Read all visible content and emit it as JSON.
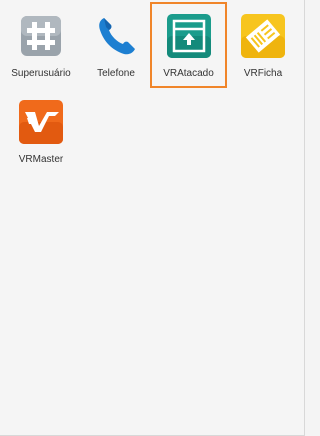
{
  "apps": [
    {
      "label": "Superusuário",
      "icon": "hash-grid-icon"
    },
    {
      "label": "Telefone",
      "icon": "phone-handset-icon"
    },
    {
      "label": "VRAtacado",
      "icon": "vr-atacado-box-icon",
      "selected": true
    },
    {
      "label": "VRFicha",
      "icon": "vr-ficha-ticket-icon"
    },
    {
      "label": "VRMaster",
      "icon": "vr-master-logo-icon"
    }
  ],
  "colors": {
    "selection_outline": "#f0852a",
    "vratacado_teal": "#1b9c8c",
    "vrficha_yellow": "#f7c51e",
    "vrmaster_orange": "#f06a1b",
    "phone_blue": "#1d7fd1"
  }
}
